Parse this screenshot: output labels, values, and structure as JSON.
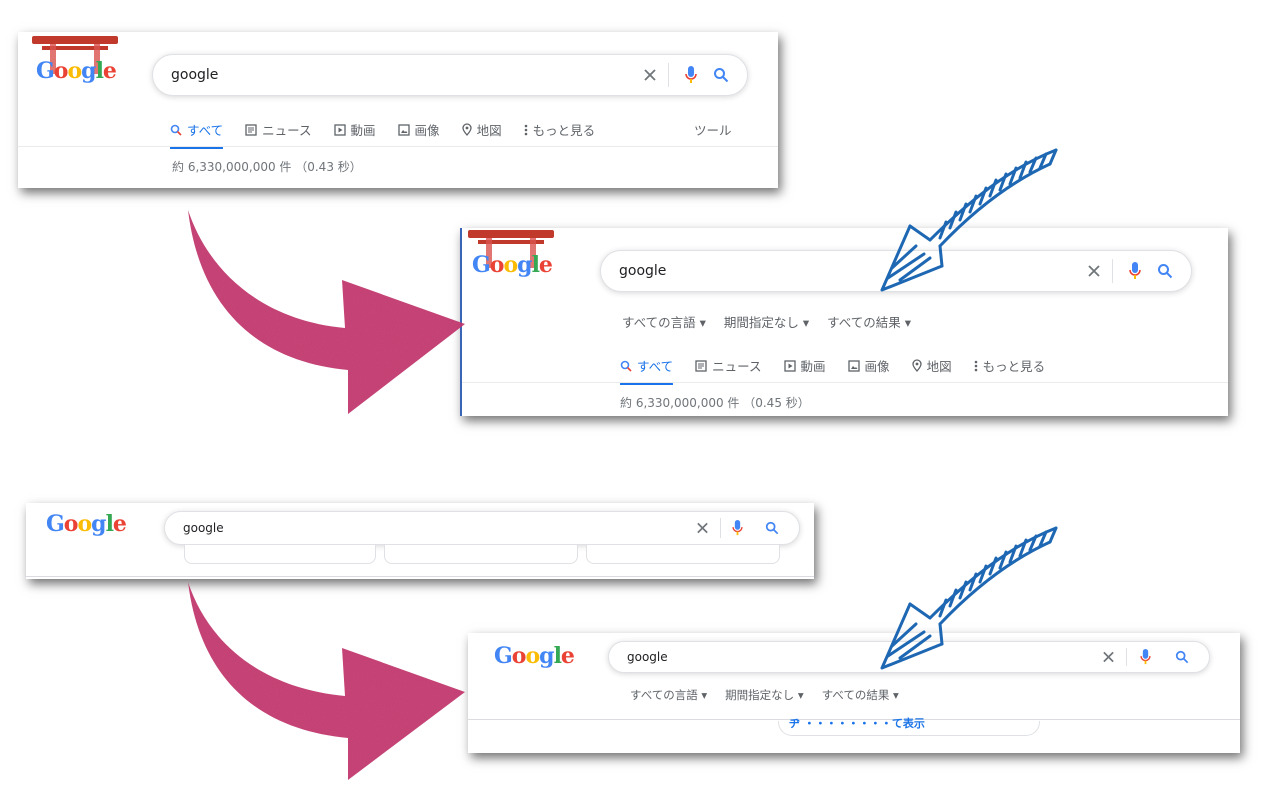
{
  "search_query": "google",
  "icons": {
    "clear": "close-icon",
    "mic": "microphone-icon",
    "search": "search-icon"
  },
  "colors": {
    "accent": "#1a73e8",
    "mic_blue": "#4285f4",
    "mic_red": "#ea4335",
    "pink_arrow": "#c8356f",
    "blue_arrow": "#1e67b3"
  },
  "logo": {
    "text": "Google"
  },
  "tabs": [
    {
      "label": "すべて",
      "icon": "search-icon"
    },
    {
      "label": "ニュース",
      "icon": "newspaper-icon"
    },
    {
      "label": "動画",
      "icon": "play-icon"
    },
    {
      "label": "画像",
      "icon": "image-icon"
    },
    {
      "label": "地図",
      "icon": "map-pin-icon"
    },
    {
      "label": "もっと見る",
      "icon": "more-vert-icon"
    }
  ],
  "tools_label": "ツール",
  "filters": [
    "すべての言語 ▾",
    "期間指定なし ▾",
    "すべての結果 ▾"
  ],
  "panel1": {
    "stats": "約 6,330,000,000 件 （0.43 秒）"
  },
  "panel2": {
    "stats": "約 6,330,000,000 件 （0.45 秒）"
  },
  "panel4": {
    "partial_text": "ヂ   ・・・・・・・・て表示"
  }
}
